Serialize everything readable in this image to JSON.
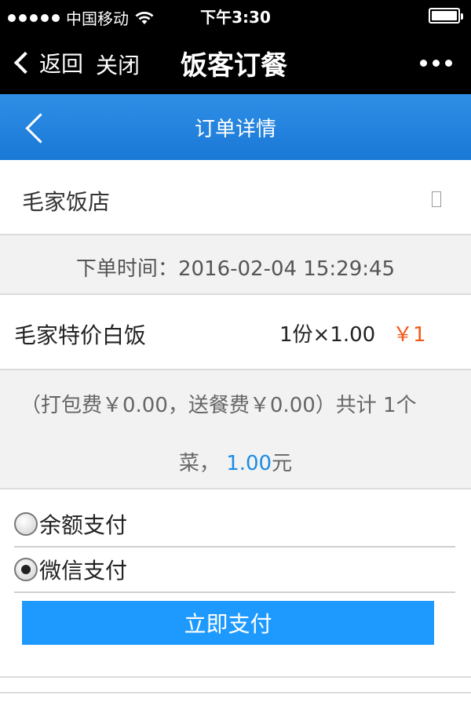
{
  "status_bar": {
    "carrier": "中国移动",
    "time": "下午3:30"
  },
  "nav": {
    "back_label": "返回",
    "close_label": "关闭",
    "title": "饭客订餐"
  },
  "header": {
    "title": "订单详情"
  },
  "shop": {
    "name": "毛家饭店"
  },
  "order": {
    "time_label": "下单时间：",
    "time_value": "2016-02-04 15:29:45",
    "item": {
      "name": "毛家特价白饭",
      "quantity_text": "1份×1.00",
      "price_text": "￥1"
    },
    "summary_line1": "（打包费￥0.00，送餐费￥0.00）共计 1个",
    "summary_prefix": "菜，",
    "summary_amount": "1.00",
    "summary_unit": "元"
  },
  "payment": {
    "options": [
      {
        "label": "余额支付",
        "selected": false
      },
      {
        "label": "微信支付",
        "selected": true
      }
    ],
    "button_label": "立即支付"
  },
  "colors": {
    "header_blue": "#1a78d6",
    "button_blue": "#1e9aff",
    "price_orange": "#f05a1a",
    "amount_blue": "#1a8ce6"
  }
}
